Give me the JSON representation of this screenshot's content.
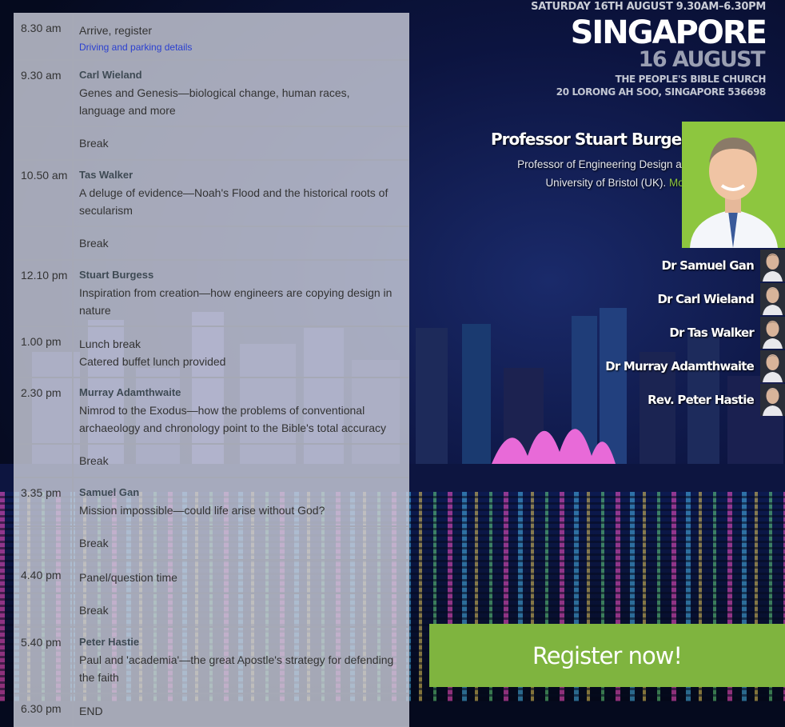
{
  "header": {
    "datetime": "SATURDAY 16TH AUGUST 9.30AM–6.30PM",
    "city": "SINGAPORE",
    "date": "16 AUGUST",
    "venue": "THE PEOPLE'S BIBLE CHURCH",
    "address": "20 LORONG AH SOO, SINGAPORE 536698"
  },
  "featured": {
    "name": "Professor Stuart Burgess",
    "bio": "Professor of Engineering Design at the University of Bristol (UK).",
    "more_label": "More..."
  },
  "speakers": [
    "Dr Samuel Gan",
    "Dr Carl Wieland",
    "Dr Tas Walker",
    "Dr Murray Adamthwaite",
    "Rev. Peter Hastie"
  ],
  "schedule": [
    {
      "time": "8.30 am",
      "speaker": "",
      "title": "Arrive, register",
      "link": "Driving and parking details"
    },
    {
      "time": "9.30 am",
      "speaker": "Carl Wieland",
      "title": "Genes and Genesis—biological change, human races, language and more",
      "link": ""
    },
    {
      "time": "",
      "speaker": "",
      "title": "Break",
      "link": ""
    },
    {
      "time": "10.50 am",
      "speaker": "Tas Walker",
      "title": "A deluge of evidence—Noah's Flood and the historical roots of secularism",
      "link": ""
    },
    {
      "time": "",
      "speaker": "",
      "title": "Break",
      "link": ""
    },
    {
      "time": "12.10 pm",
      "speaker": "Stuart Burgess",
      "title": "Inspiration from creation—how engineers are copying design in nature",
      "link": ""
    },
    {
      "time": "1.00 pm",
      "speaker": "",
      "title": "Lunch break",
      "subtitle": "Catered buffet lunch provided",
      "link": ""
    },
    {
      "time": "2.30 pm",
      "speaker": "Murray Adamthwaite",
      "title": "Nimrod to the Exodus—how the problems of conventional archaeology and chronology point to the Bible's total accuracy",
      "link": ""
    },
    {
      "time": "",
      "speaker": "",
      "title": "Break",
      "link": ""
    },
    {
      "time": "3.35 pm",
      "speaker": "Samuel Gan",
      "title": "Mission impossible—could life arise without God?",
      "link": ""
    },
    {
      "time": "",
      "speaker": "",
      "title": "Break",
      "link": ""
    },
    {
      "time": "4.40 pm",
      "speaker": "",
      "title": "Panel/question time",
      "link": ""
    },
    {
      "time": "",
      "speaker": "",
      "title": "Break",
      "link": ""
    },
    {
      "time": "5.40 pm",
      "speaker": "Peter Hastie",
      "title": "Paul and 'academia'—the great Apostle's strategy for defending the faith",
      "link": ""
    },
    {
      "time": "6.30 pm",
      "speaker": "",
      "title": "END",
      "link": ""
    }
  ],
  "register_label": "Register now!",
  "colors": {
    "accent_green": "#7fb43f",
    "link_blue": "#2a3fd0",
    "more_green": "#8dc63f"
  }
}
